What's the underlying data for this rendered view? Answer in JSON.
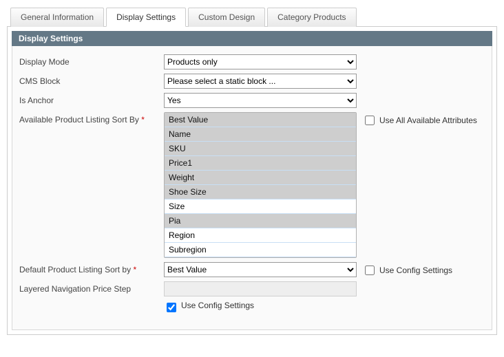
{
  "tabs": {
    "general": "General Information",
    "display": "Display Settings",
    "design": "Custom Design",
    "products": "Category Products"
  },
  "section_title": "Display Settings",
  "labels": {
    "display_mode": "Display Mode",
    "cms_block": "CMS Block",
    "is_anchor": "Is Anchor",
    "available_sort": "Available Product Listing Sort By",
    "default_sort": "Default Product Listing Sort by",
    "price_step": "Layered Navigation Price Step"
  },
  "fields": {
    "display_mode": {
      "value": "Products only"
    },
    "cms_block": {
      "value": "Please select a static block ..."
    },
    "is_anchor": {
      "value": "Yes"
    },
    "available_sort": {
      "options": [
        "Best Value",
        "Name",
        "SKU",
        "Price1",
        "Weight",
        "Shoe Size",
        "Size",
        "Pia",
        "Region",
        "Subregion"
      ],
      "selected": [
        "Best Value",
        "Name",
        "SKU",
        "Price1",
        "Weight",
        "Shoe Size",
        "Pia"
      ]
    },
    "default_sort": {
      "value": "Best Value"
    },
    "price_step": {
      "value": ""
    }
  },
  "checkboxes": {
    "use_all_attrs": {
      "label": "Use All Available Attributes",
      "checked": false
    },
    "use_config_default": {
      "label": "Use Config Settings",
      "checked": false
    },
    "use_config_price": {
      "label": "Use Config Settings",
      "checked": true
    }
  },
  "required_marker": "*"
}
